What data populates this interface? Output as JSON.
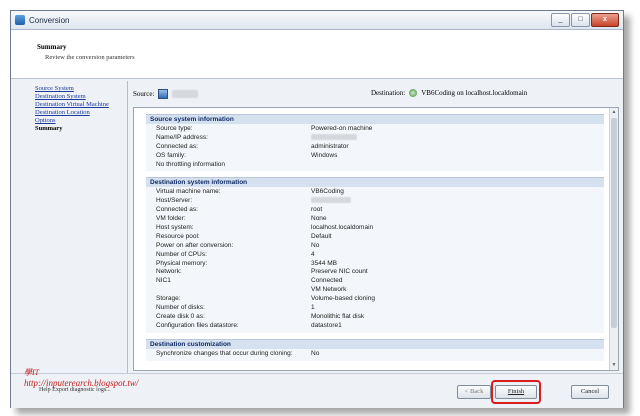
{
  "window": {
    "title": "Conversion",
    "controls": [
      "_",
      "□",
      "x"
    ]
  },
  "header": {
    "title": "Summary",
    "subtitle": "Review the conversion parameters"
  },
  "nav": {
    "items": [
      {
        "label": "Source System",
        "current": false
      },
      {
        "label": "Destination System",
        "current": false
      },
      {
        "label": "Destination Virtual Machine",
        "current": false
      },
      {
        "label": "Destination Location",
        "current": false
      },
      {
        "label": "Options",
        "current": false
      },
      {
        "label": "Summary",
        "current": true
      }
    ]
  },
  "source_bar": {
    "label": "Source:"
  },
  "destination_bar": {
    "label": "Destination:",
    "value": "VB6Coding on localhost.localdomain"
  },
  "sections": [
    {
      "title": "Source system information",
      "rows": [
        {
          "key": "Source type:",
          "value": "Powered-on machine"
        },
        {
          "key": "Name/IP address:",
          "value": ""
        },
        {
          "key": "Connected as:",
          "value": "administrator"
        },
        {
          "key": "OS family:",
          "value": "Windows"
        },
        {
          "key": "No throttling information",
          "value": ""
        }
      ]
    },
    {
      "title": "Destination system information",
      "rows": [
        {
          "key": "Virtual machine name:",
          "value": "VB6Coding"
        },
        {
          "key": "Host/Server:",
          "value": ""
        },
        {
          "key": "Connected as:",
          "value": "root"
        },
        {
          "key": "VM folder:",
          "value": "None"
        },
        {
          "key": "Host system:",
          "value": "localhost.localdomain"
        },
        {
          "key": "Resource pool:",
          "value": "Default"
        },
        {
          "key": "Power on after conversion:",
          "value": "No"
        },
        {
          "key": "Number of CPUs:",
          "value": "4"
        },
        {
          "key": "Physical memory:",
          "value": "3544 MB"
        },
        {
          "key": "Network:",
          "value": "Preserve NIC count"
        },
        {
          "key": "NIC1",
          "value": "Connected"
        },
        {
          "key": "",
          "value": "VM Network"
        },
        {
          "key": "Storage:",
          "value": "Volume-based cloning"
        },
        {
          "key": "Number of disks:",
          "value": "1"
        },
        {
          "key": "Create disk 0 as:",
          "value": "Monolithic flat disk"
        },
        {
          "key": "Configuration files datastore:",
          "value": "datastore1"
        }
      ]
    },
    {
      "title": "Destination customization",
      "rows": [
        {
          "key": "Synchronize changes that occur during cloning:",
          "value": "No"
        }
      ]
    }
  ],
  "footer": {
    "help_link": "Help  Export diagnostic logs...",
    "back_label": "< Back",
    "finish_label": "Finish",
    "cancel_label": "Cancel"
  },
  "watermark": {
    "line1": "學IT",
    "line2": "http://inputerearch.blogspot.tw/"
  },
  "colors": {
    "highlight_ring": "#d81e1e",
    "section_header_bg": "#d6e1ef",
    "link": "#1a3a9c"
  }
}
